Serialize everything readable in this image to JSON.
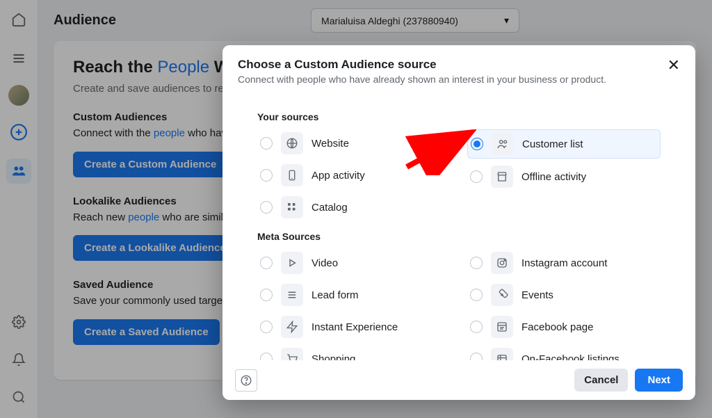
{
  "page": {
    "title": "Audience",
    "account": "Marialuisa Aldeghi (237880940)"
  },
  "hero": {
    "heading_before": "Reach the ",
    "heading_link": "People",
    "heading_after": " Who Matter",
    "subtitle": "Create and save audiences to reach"
  },
  "sections": {
    "custom": {
      "head": "Custom Audiences",
      "body_before": "Connect with the ",
      "body_link": "people",
      "body_after": " who have already shown an interest. Custom Audiences. You can create audiences from your mobile app.",
      "button": "Create a Custom Audience"
    },
    "lookalike": {
      "head": "Lookalike Audiences",
      "body_before": "Reach new ",
      "body_link": "people",
      "body_after": " who are similar to your lookalike audience based on people in Custom Audiences.",
      "button": "Create a Lookalike Audience"
    },
    "saved": {
      "head": "Saved Audience",
      "body": "Save your commonly used targeting such as interests, and behaviors, then save them.",
      "button": "Create a Saved Audience"
    }
  },
  "modal": {
    "title": "Choose a Custom Audience source",
    "subtitle": "Connect with people who have already shown an interest in your business or product.",
    "groups": {
      "your": {
        "title": "Your sources",
        "left": [
          {
            "icon": "globe",
            "label": "Website"
          },
          {
            "icon": "app",
            "label": "App activity"
          },
          {
            "icon": "catalog",
            "label": "Catalog"
          }
        ],
        "right": [
          {
            "icon": "people",
            "label": "Customer list",
            "selected": true
          },
          {
            "icon": "store",
            "label": "Offline activity"
          }
        ]
      },
      "meta": {
        "title": "Meta Sources",
        "left": [
          {
            "icon": "video",
            "label": "Video"
          },
          {
            "icon": "form",
            "label": "Lead form"
          },
          {
            "icon": "instant",
            "label": "Instant Experience"
          },
          {
            "icon": "shopping",
            "label": "Shopping"
          }
        ],
        "right": [
          {
            "icon": "instagram",
            "label": "Instagram account"
          },
          {
            "icon": "events",
            "label": "Events"
          },
          {
            "icon": "fbpage",
            "label": "Facebook page"
          },
          {
            "icon": "listings",
            "label": "On-Facebook listings"
          }
        ]
      }
    },
    "cancel": "Cancel",
    "next": "Next"
  }
}
